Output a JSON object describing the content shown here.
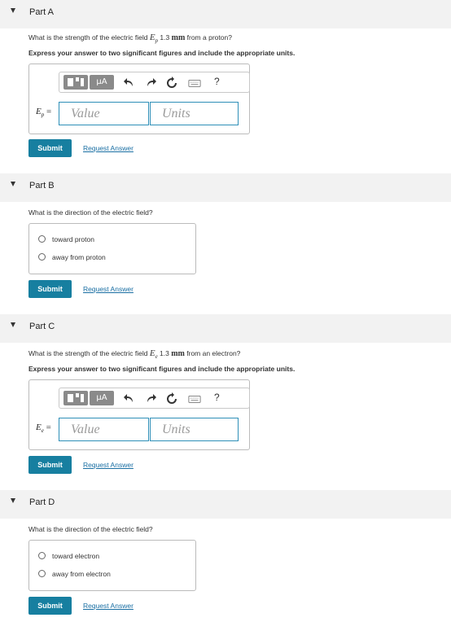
{
  "parts": [
    {
      "title": "Part A",
      "question_prefix": "What is the strength of the electric field ",
      "var": "E",
      "var_sub": "p",
      "distance": " 1.3 ",
      "unit": "mm",
      "question_suffix": " from a proton?",
      "instruction": "Express your answer to two significant figures and include the appropriate units.",
      "input_label_eq": " =",
      "value_placeholder": "Value",
      "units_placeholder": "Units",
      "units_button": "μA",
      "help": "?",
      "submit": "Submit",
      "request": "Request Answer"
    },
    {
      "title": "Part B",
      "question": "What is the direction of the electric field?",
      "options": [
        "toward proton",
        "away from proton"
      ],
      "submit": "Submit",
      "request": "Request Answer"
    },
    {
      "title": "Part C",
      "question_prefix": "What is the strength of the electric field ",
      "var": "E",
      "var_sub": "e",
      "distance": " 1.3 ",
      "unit": "mm",
      "question_suffix": " from an electron?",
      "instruction": "Express your answer to two significant figures and include the appropriate units.",
      "input_label_eq": " =",
      "value_placeholder": "Value",
      "units_placeholder": "Units",
      "units_button": "μA",
      "help": "?",
      "submit": "Submit",
      "request": "Request Answer"
    },
    {
      "title": "Part D",
      "question": "What is the direction of the electric field?",
      "options": [
        "toward electron",
        "away from electron"
      ],
      "submit": "Submit",
      "request": "Request Answer"
    }
  ]
}
